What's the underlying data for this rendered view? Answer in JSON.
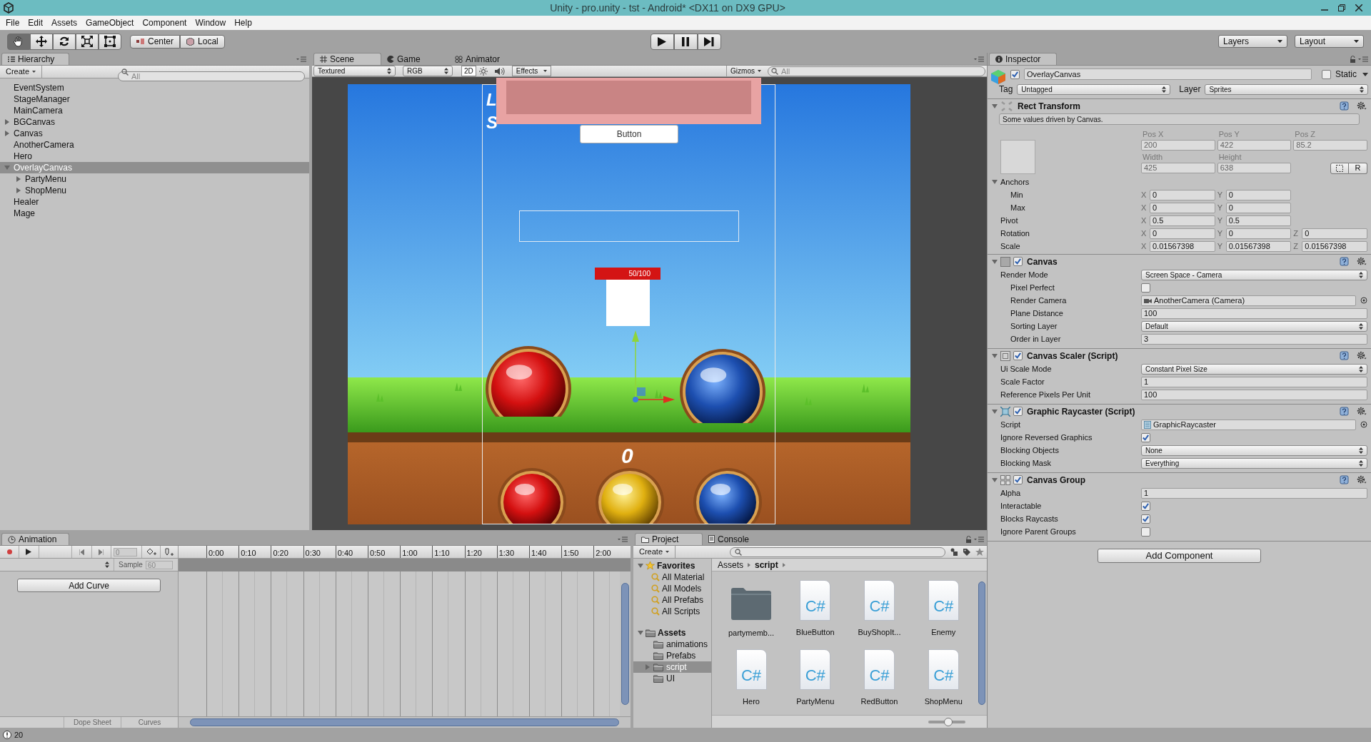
{
  "window": {
    "title": "Unity - pro.unity - tst - Android* <DX11 on DX9 GPU>"
  },
  "menu": [
    "File",
    "Edit",
    "Assets",
    "GameObject",
    "Component",
    "Window",
    "Help"
  ],
  "toolbar": {
    "tools": [
      {
        "kind": "hand",
        "selected": true
      },
      {
        "kind": "move",
        "selected": false
      },
      {
        "kind": "rotate",
        "selected": false
      },
      {
        "kind": "scale",
        "selected": false
      },
      {
        "kind": "rect",
        "selected": false
      }
    ],
    "pivot": [
      {
        "kind": "center",
        "label": "Center"
      },
      {
        "kind": "local",
        "label": "Local"
      }
    ],
    "play": [
      {
        "kind": "play"
      },
      {
        "kind": "pause"
      },
      {
        "kind": "step"
      }
    ],
    "layers": "Layers",
    "layout": "Layout"
  },
  "hierarchy": {
    "tab": "Hierarchy",
    "create": "Create",
    "placeholder": "All",
    "items": [
      {
        "label": "EventSystem",
        "selected": false
      },
      {
        "label": "StageManager",
        "selected": false
      },
      {
        "label": "MainCamera",
        "selected": false
      },
      {
        "label": "BGCanvas",
        "selected": false,
        "expanded": false
      },
      {
        "label": "Canvas",
        "selected": false,
        "expanded": false
      },
      {
        "label": "AnotherCamera",
        "selected": false
      },
      {
        "label": "Hero",
        "selected": false
      },
      {
        "label": "OverlayCanvas",
        "selected": true,
        "expanded": true,
        "children": [
          {
            "label": "PartyMenu",
            "selected": false,
            "expanded": false
          },
          {
            "label": "ShopMenu",
            "selected": false,
            "expanded": false
          }
        ]
      },
      {
        "label": "Healer",
        "selected": false
      },
      {
        "label": "Mage",
        "selected": false
      }
    ]
  },
  "scene": {
    "tabs": [
      {
        "kind": "scene",
        "label": "Scene",
        "selected": true
      },
      {
        "kind": "game",
        "label": "Game",
        "selected": false
      },
      {
        "kind": "animator",
        "label": "Animator",
        "selected": false
      }
    ],
    "draw_mode": "Textured",
    "render_mode": "RGB",
    "mode_2d": {
      "label": "2D",
      "on": true
    },
    "effects": "Effects",
    "gizmos": "Gizmos",
    "placeholder": "All",
    "view": {
      "fragments": [
        "L",
        "S"
      ],
      "button": "Button",
      "health": "50/100",
      "score": "0"
    }
  },
  "inspector": {
    "tab": "Inspector",
    "object": {
      "name": "OverlayCanvas",
      "active": true,
      "static": false,
      "static_label": "Static"
    },
    "tag_label": "Tag",
    "tag": "Untagged",
    "layer_label": "Layer",
    "layer": "Sprites",
    "rect_transform": {
      "title": "Rect Transform",
      "expanded": true,
      "driven": true,
      "note": "Some values driven by Canvas.",
      "position": [
        {
          "label": "Pos X",
          "value": "200"
        },
        {
          "label": "Pos Y",
          "value": "422"
        },
        {
          "label": "Pos Z",
          "value": "85.2"
        }
      ],
      "size": [
        {
          "label": "Width",
          "value": "425"
        },
        {
          "label": "Height",
          "value": "638"
        }
      ],
      "raw_button": "R",
      "rows": [
        {
          "kind": "group",
          "label": "Anchors",
          "expanded": true,
          "children": [
            {
              "kind": "vector",
              "label": "Min",
              "values": [
                {
                  "axis": "X",
                  "value": "0"
                },
                {
                  "axis": "Y",
                  "value": "0"
                }
              ]
            },
            {
              "kind": "vector",
              "label": "Max",
              "values": [
                {
                  "axis": "X",
                  "value": "0"
                },
                {
                  "axis": "Y",
                  "value": "0"
                }
              ]
            }
          ]
        },
        {
          "kind": "vector",
          "label": "Pivot",
          "values": [
            {
              "axis": "X",
              "value": "0.5"
            },
            {
              "axis": "Y",
              "value": "0.5"
            }
          ]
        },
        {
          "kind": "vector",
          "label": "Rotation",
          "values": [
            {
              "axis": "X",
              "value": "0"
            },
            {
              "axis": "Y",
              "value": "0"
            },
            {
              "axis": "Z",
              "value": "0"
            }
          ]
        },
        {
          "kind": "vector",
          "label": "Scale",
          "values": [
            {
              "axis": "X",
              "value": "0.01567398"
            },
            {
              "axis": "Y",
              "value": "0.01567398"
            },
            {
              "axis": "Z",
              "value": "0.01567398"
            }
          ]
        }
      ]
    },
    "components": [
      {
        "kind": "canvas",
        "title": "Canvas",
        "enabled": true,
        "expanded": true,
        "rows": [
          {
            "kind": "dropdown",
            "label": "Render Mode",
            "value": "Screen Space - Camera",
            "children": [
              {
                "kind": "checkbox",
                "label": "Pixel Perfect",
                "checked": false
              },
              {
                "kind": "camera_ref",
                "label": "Render Camera",
                "value": "AnotherCamera (Camera)"
              },
              {
                "kind": "field",
                "label": "Plane Distance",
                "value": "100"
              },
              {
                "kind": "dropdown",
                "label": "Sorting Layer",
                "value": "Default"
              },
              {
                "kind": "field",
                "label": "Order in Layer",
                "value": "3"
              }
            ]
          }
        ]
      },
      {
        "kind": "scaler",
        "title": "Canvas Scaler (Script)",
        "enabled": true,
        "expanded": true,
        "rows": [
          {
            "kind": "dropdown",
            "label": "Ui Scale Mode",
            "value": "Constant Pixel Size"
          },
          {
            "kind": "field",
            "label": "Scale Factor",
            "value": "1"
          },
          {
            "kind": "field",
            "label": "Reference Pixels Per Unit",
            "value": "100"
          }
        ]
      },
      {
        "kind": "raycaster",
        "title": "Graphic Raycaster (Script)",
        "enabled": true,
        "expanded": true,
        "rows": [
          {
            "kind": "script_ref",
            "label": "Script",
            "value": "GraphicRaycaster"
          },
          {
            "kind": "checkbox",
            "label": "Ignore Reversed Graphics",
            "checked": true
          },
          {
            "kind": "dropdown",
            "label": "Blocking Objects",
            "value": "None"
          },
          {
            "kind": "dropdown",
            "label": "Blocking Mask",
            "value": "Everything"
          }
        ]
      },
      {
        "kind": "group",
        "title": "Canvas Group",
        "enabled": true,
        "expanded": true,
        "rows": [
          {
            "kind": "field",
            "label": "Alpha",
            "value": "1"
          },
          {
            "kind": "checkbox",
            "label": "Interactable",
            "checked": true
          },
          {
            "kind": "checkbox",
            "label": "Blocks Raycasts",
            "checked": true
          },
          {
            "kind": "checkbox",
            "label": "Ignore Parent Groups",
            "checked": false
          }
        ]
      }
    ],
    "add_component": "Add Component"
  },
  "animation": {
    "tab": "Animation",
    "frame": "0",
    "sample_label": "Sample",
    "sample": "60",
    "ticks": [
      "0:00",
      "0:10",
      "0:20",
      "0:30",
      "0:40",
      "0:50",
      "1:00",
      "1:10",
      "1:20",
      "1:30",
      "1:40",
      "1:50",
      "2:00"
    ],
    "add_curve": "Add Curve",
    "modes": [
      {
        "label": "Dope Sheet",
        "selected": false
      },
      {
        "label": "Curves",
        "selected": false
      }
    ]
  },
  "project": {
    "tabs": [
      {
        "kind": "project",
        "label": "Project",
        "selected": true
      },
      {
        "kind": "console",
        "label": "Console",
        "selected": false
      }
    ],
    "create": "Create",
    "favorites": {
      "label": "Favorites",
      "expanded": true,
      "items": [
        "All Material",
        "All Models",
        "All Prefabs",
        "All Scripts"
      ]
    },
    "assets": {
      "label": "Assets",
      "expanded": true,
      "children": [
        {
          "label": "animations",
          "selected": false
        },
        {
          "label": "Prefabs",
          "selected": false
        },
        {
          "label": "script",
          "selected": true,
          "expanded": false
        },
        {
          "label": "UI",
          "selected": false
        }
      ]
    },
    "breadcrumb": [
      "Assets",
      "script"
    ],
    "zoom": {
      "level": 0.55
    },
    "items": [
      {
        "kind": "folder",
        "label": "partymemb..."
      },
      {
        "kind": "script",
        "label": "BlueButton",
        "glyph": "C#"
      },
      {
        "kind": "script",
        "label": "BuyShopIt...",
        "glyph": "C#"
      },
      {
        "kind": "script",
        "label": "Enemy",
        "glyph": "C#"
      },
      {
        "kind": "script",
        "label": "Hero",
        "glyph": "C#"
      },
      {
        "kind": "script",
        "label": "PartyMenu",
        "glyph": "C#"
      },
      {
        "kind": "script",
        "label": "RedButton",
        "glyph": "C#"
      },
      {
        "kind": "script",
        "label": "ShopMenu",
        "glyph": "C#"
      }
    ]
  },
  "status_bar": {
    "count": "20"
  }
}
